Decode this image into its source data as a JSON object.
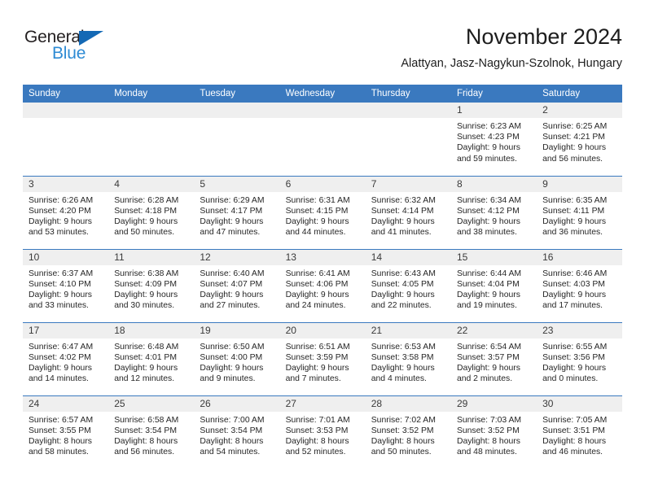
{
  "brand": {
    "name_part1": "General",
    "name_part2": "Blue",
    "triangle_color": "#1469b5",
    "blue_text_color": "#2e8bd4"
  },
  "header": {
    "title": "November 2024",
    "subtitle": "Alattyan, Jasz-Nagykun-Szolnok, Hungary"
  },
  "theme": {
    "header_blue": "#3a79bf",
    "daynum_bg": "#efefef",
    "text": "#262626"
  },
  "weekday_headers": [
    "Sunday",
    "Monday",
    "Tuesday",
    "Wednesday",
    "Thursday",
    "Friday",
    "Saturday"
  ],
  "weeks": [
    [
      {
        "day": "",
        "sunrise": "",
        "sunset": "",
        "daylight_line1": "",
        "daylight_line2": ""
      },
      {
        "day": "",
        "sunrise": "",
        "sunset": "",
        "daylight_line1": "",
        "daylight_line2": ""
      },
      {
        "day": "",
        "sunrise": "",
        "sunset": "",
        "daylight_line1": "",
        "daylight_line2": ""
      },
      {
        "day": "",
        "sunrise": "",
        "sunset": "",
        "daylight_line1": "",
        "daylight_line2": ""
      },
      {
        "day": "",
        "sunrise": "",
        "sunset": "",
        "daylight_line1": "",
        "daylight_line2": ""
      },
      {
        "day": "1",
        "sunrise": "Sunrise: 6:23 AM",
        "sunset": "Sunset: 4:23 PM",
        "daylight_line1": "Daylight: 9 hours",
        "daylight_line2": "and 59 minutes."
      },
      {
        "day": "2",
        "sunrise": "Sunrise: 6:25 AM",
        "sunset": "Sunset: 4:21 PM",
        "daylight_line1": "Daylight: 9 hours",
        "daylight_line2": "and 56 minutes."
      }
    ],
    [
      {
        "day": "3",
        "sunrise": "Sunrise: 6:26 AM",
        "sunset": "Sunset: 4:20 PM",
        "daylight_line1": "Daylight: 9 hours",
        "daylight_line2": "and 53 minutes."
      },
      {
        "day": "4",
        "sunrise": "Sunrise: 6:28 AM",
        "sunset": "Sunset: 4:18 PM",
        "daylight_line1": "Daylight: 9 hours",
        "daylight_line2": "and 50 minutes."
      },
      {
        "day": "5",
        "sunrise": "Sunrise: 6:29 AM",
        "sunset": "Sunset: 4:17 PM",
        "daylight_line1": "Daylight: 9 hours",
        "daylight_line2": "and 47 minutes."
      },
      {
        "day": "6",
        "sunrise": "Sunrise: 6:31 AM",
        "sunset": "Sunset: 4:15 PM",
        "daylight_line1": "Daylight: 9 hours",
        "daylight_line2": "and 44 minutes."
      },
      {
        "day": "7",
        "sunrise": "Sunrise: 6:32 AM",
        "sunset": "Sunset: 4:14 PM",
        "daylight_line1": "Daylight: 9 hours",
        "daylight_line2": "and 41 minutes."
      },
      {
        "day": "8",
        "sunrise": "Sunrise: 6:34 AM",
        "sunset": "Sunset: 4:12 PM",
        "daylight_line1": "Daylight: 9 hours",
        "daylight_line2": "and 38 minutes."
      },
      {
        "day": "9",
        "sunrise": "Sunrise: 6:35 AM",
        "sunset": "Sunset: 4:11 PM",
        "daylight_line1": "Daylight: 9 hours",
        "daylight_line2": "and 36 minutes."
      }
    ],
    [
      {
        "day": "10",
        "sunrise": "Sunrise: 6:37 AM",
        "sunset": "Sunset: 4:10 PM",
        "daylight_line1": "Daylight: 9 hours",
        "daylight_line2": "and 33 minutes."
      },
      {
        "day": "11",
        "sunrise": "Sunrise: 6:38 AM",
        "sunset": "Sunset: 4:09 PM",
        "daylight_line1": "Daylight: 9 hours",
        "daylight_line2": "and 30 minutes."
      },
      {
        "day": "12",
        "sunrise": "Sunrise: 6:40 AM",
        "sunset": "Sunset: 4:07 PM",
        "daylight_line1": "Daylight: 9 hours",
        "daylight_line2": "and 27 minutes."
      },
      {
        "day": "13",
        "sunrise": "Sunrise: 6:41 AM",
        "sunset": "Sunset: 4:06 PM",
        "daylight_line1": "Daylight: 9 hours",
        "daylight_line2": "and 24 minutes."
      },
      {
        "day": "14",
        "sunrise": "Sunrise: 6:43 AM",
        "sunset": "Sunset: 4:05 PM",
        "daylight_line1": "Daylight: 9 hours",
        "daylight_line2": "and 22 minutes."
      },
      {
        "day": "15",
        "sunrise": "Sunrise: 6:44 AM",
        "sunset": "Sunset: 4:04 PM",
        "daylight_line1": "Daylight: 9 hours",
        "daylight_line2": "and 19 minutes."
      },
      {
        "day": "16",
        "sunrise": "Sunrise: 6:46 AM",
        "sunset": "Sunset: 4:03 PM",
        "daylight_line1": "Daylight: 9 hours",
        "daylight_line2": "and 17 minutes."
      }
    ],
    [
      {
        "day": "17",
        "sunrise": "Sunrise: 6:47 AM",
        "sunset": "Sunset: 4:02 PM",
        "daylight_line1": "Daylight: 9 hours",
        "daylight_line2": "and 14 minutes."
      },
      {
        "day": "18",
        "sunrise": "Sunrise: 6:48 AM",
        "sunset": "Sunset: 4:01 PM",
        "daylight_line1": "Daylight: 9 hours",
        "daylight_line2": "and 12 minutes."
      },
      {
        "day": "19",
        "sunrise": "Sunrise: 6:50 AM",
        "sunset": "Sunset: 4:00 PM",
        "daylight_line1": "Daylight: 9 hours",
        "daylight_line2": "and 9 minutes."
      },
      {
        "day": "20",
        "sunrise": "Sunrise: 6:51 AM",
        "sunset": "Sunset: 3:59 PM",
        "daylight_line1": "Daylight: 9 hours",
        "daylight_line2": "and 7 minutes."
      },
      {
        "day": "21",
        "sunrise": "Sunrise: 6:53 AM",
        "sunset": "Sunset: 3:58 PM",
        "daylight_line1": "Daylight: 9 hours",
        "daylight_line2": "and 4 minutes."
      },
      {
        "day": "22",
        "sunrise": "Sunrise: 6:54 AM",
        "sunset": "Sunset: 3:57 PM",
        "daylight_line1": "Daylight: 9 hours",
        "daylight_line2": "and 2 minutes."
      },
      {
        "day": "23",
        "sunrise": "Sunrise: 6:55 AM",
        "sunset": "Sunset: 3:56 PM",
        "daylight_line1": "Daylight: 9 hours",
        "daylight_line2": "and 0 minutes."
      }
    ],
    [
      {
        "day": "24",
        "sunrise": "Sunrise: 6:57 AM",
        "sunset": "Sunset: 3:55 PM",
        "daylight_line1": "Daylight: 8 hours",
        "daylight_line2": "and 58 minutes."
      },
      {
        "day": "25",
        "sunrise": "Sunrise: 6:58 AM",
        "sunset": "Sunset: 3:54 PM",
        "daylight_line1": "Daylight: 8 hours",
        "daylight_line2": "and 56 minutes."
      },
      {
        "day": "26",
        "sunrise": "Sunrise: 7:00 AM",
        "sunset": "Sunset: 3:54 PM",
        "daylight_line1": "Daylight: 8 hours",
        "daylight_line2": "and 54 minutes."
      },
      {
        "day": "27",
        "sunrise": "Sunrise: 7:01 AM",
        "sunset": "Sunset: 3:53 PM",
        "daylight_line1": "Daylight: 8 hours",
        "daylight_line2": "and 52 minutes."
      },
      {
        "day": "28",
        "sunrise": "Sunrise: 7:02 AM",
        "sunset": "Sunset: 3:52 PM",
        "daylight_line1": "Daylight: 8 hours",
        "daylight_line2": "and 50 minutes."
      },
      {
        "day": "29",
        "sunrise": "Sunrise: 7:03 AM",
        "sunset": "Sunset: 3:52 PM",
        "daylight_line1": "Daylight: 8 hours",
        "daylight_line2": "and 48 minutes."
      },
      {
        "day": "30",
        "sunrise": "Sunrise: 7:05 AM",
        "sunset": "Sunset: 3:51 PM",
        "daylight_line1": "Daylight: 8 hours",
        "daylight_line2": "and 46 minutes."
      }
    ]
  ]
}
